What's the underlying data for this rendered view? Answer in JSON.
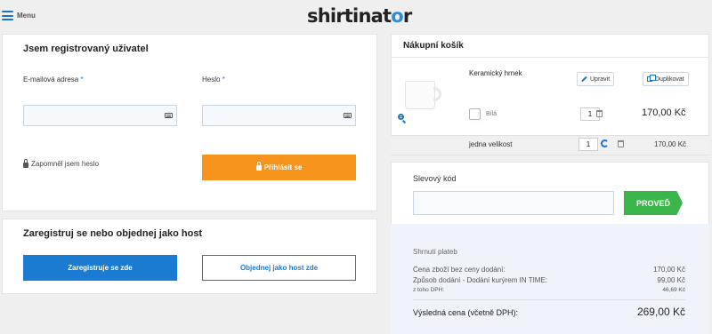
{
  "header": {
    "menu_label": "Menu",
    "logo_pre": "shirtinat",
    "logo_o": "o",
    "logo_post": "r"
  },
  "login": {
    "title": "Jsem registrovaný uživatel",
    "email_label": "E-mailová adresa",
    "password_label": "Heslo",
    "required_mark": "*",
    "email_value": "",
    "password_value": "",
    "forgot_label": "Zapomněl jsem heslo",
    "login_button": "Přihlásit se"
  },
  "register": {
    "title": "Zaregistruj se nebo objednej jako host",
    "register_button": "Zaregistruje se zde",
    "guest_button": "Objednej jako host zde"
  },
  "cart": {
    "title": "Nákupní košík",
    "item": {
      "name": "Keramický hrnek",
      "edit_label": "Upravit",
      "duplicate_label": "Duplikovat",
      "color_label": "Bílá",
      "quantity": "1",
      "price": "170,00 Kč",
      "size_label": "jedna velikost",
      "size_quantity": "1",
      "size_price": "170,00 Kč"
    }
  },
  "discount": {
    "label": "Slevový kód",
    "value": "",
    "button": "PROVEĎ"
  },
  "summary": {
    "title": "Shrnutí plateb",
    "rows": [
      {
        "label": "Cena zboží bez ceny dodání:",
        "value": "170,00 Kč"
      },
      {
        "label": "Způsob dodání - Dodání kurýrem IN TIME:",
        "value": "99,00 Kč"
      },
      {
        "label": "z toho DPH:",
        "value": "46,69 Kč"
      }
    ],
    "total_label": "Výsledná cena (včetně DPH):",
    "total_value": "269,00 Kč"
  },
  "colors": {
    "accent_blue": "#1a7bd0",
    "orange": "#f7941d",
    "green": "#3ab54a"
  }
}
